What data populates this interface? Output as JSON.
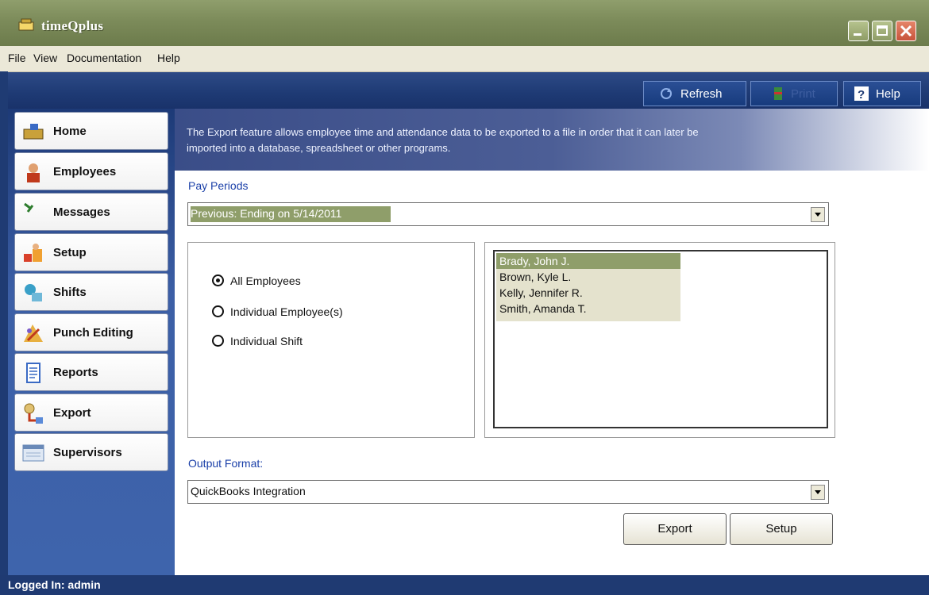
{
  "window": {
    "title": "timeQplus"
  },
  "menu": [
    "File",
    "View",
    "Documentation",
    "Help"
  ],
  "toolbar": {
    "refresh_label": "Refresh",
    "print_label": "Print",
    "help_label": "Help"
  },
  "sidebar": {
    "items": [
      {
        "label": "Home",
        "icon": "home-icon"
      },
      {
        "label": "Employees",
        "icon": "employees-icon"
      },
      {
        "label": "Messages",
        "icon": "messages-icon"
      },
      {
        "label": "Setup",
        "icon": "setup-icon"
      },
      {
        "label": "Shifts",
        "icon": "shifts-icon"
      },
      {
        "label": "Punch Editing",
        "icon": "punch-editing-icon"
      },
      {
        "label": "Reports",
        "icon": "reports-icon"
      },
      {
        "label": "Export",
        "icon": "export-icon"
      },
      {
        "label": "Supervisors",
        "icon": "supervisors-icon"
      }
    ]
  },
  "main": {
    "info_line1": "The Export feature allows employee time and attendance data to be exported to a file in order that it can later be",
    "info_line2": "imported into a database, spreadsheet or other programs.",
    "pay_periods_label": "Pay Periods",
    "pay_period_value": "Previous:  Ending on 5/14/2011",
    "radios": [
      {
        "label": "All Employees",
        "selected": true
      },
      {
        "label": "Individual Employee(s)",
        "selected": false
      },
      {
        "label": "Individual Shift",
        "selected": false
      }
    ],
    "employees": [
      {
        "name": "Brady, John J.",
        "selected": true
      },
      {
        "name": "Brown, Kyle L.",
        "selected": false
      },
      {
        "name": "Kelly, Jennifer R.",
        "selected": false
      },
      {
        "name": "Smith, Amanda T.",
        "selected": false
      }
    ],
    "output_format_label": "Output Format:",
    "output_format_value": "QuickBooks Integration",
    "export_button": "Export",
    "setup_button": "Setup"
  },
  "status": {
    "logged_in": "Logged In: admin"
  },
  "colors": {
    "title_bar": "#7c8b5a",
    "nav_blue": "#1f3a72",
    "selection": "#8f9e6a",
    "label_blue": "#1a3fa8"
  }
}
